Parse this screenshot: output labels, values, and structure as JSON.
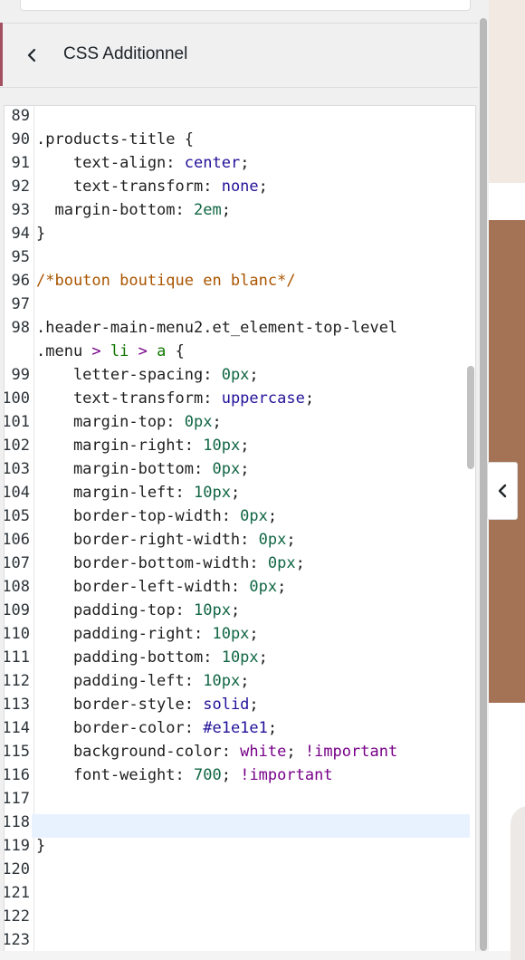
{
  "panel": {
    "title": "CSS Additionnel",
    "back_icon": "chevron-left-icon"
  },
  "editor": {
    "lines": [
      {
        "num": "89",
        "tokens": []
      },
      {
        "num": "90",
        "tokens": [
          {
            "t": "sel",
            "v": ".products-title"
          },
          {
            "t": "punc",
            "v": " {"
          }
        ]
      },
      {
        "num": "91",
        "tokens": [
          {
            "t": "prop",
            "v": "    text-align: "
          },
          {
            "t": "kw",
            "v": "center"
          },
          {
            "t": "punc",
            "v": ";"
          }
        ]
      },
      {
        "num": "92",
        "tokens": [
          {
            "t": "prop",
            "v": "    text-transform: "
          },
          {
            "t": "kw",
            "v": "none"
          },
          {
            "t": "punc",
            "v": ";"
          }
        ]
      },
      {
        "num": "93",
        "tokens": [
          {
            "t": "prop",
            "v": "  margin-bottom: "
          },
          {
            "t": "num",
            "v": "2em"
          },
          {
            "t": "punc",
            "v": ";"
          }
        ]
      },
      {
        "num": "94",
        "tokens": [
          {
            "t": "punc",
            "v": "}"
          }
        ]
      },
      {
        "num": "95",
        "tokens": []
      },
      {
        "num": "96",
        "tokens": [
          {
            "t": "comment",
            "v": "/*bouton boutique en blanc*/"
          }
        ]
      },
      {
        "num": "97",
        "tokens": []
      },
      {
        "num": "98",
        "tokens": [
          {
            "t": "sel",
            "v": ".header-main-menu2.et_element-top-level"
          }
        ]
      },
      {
        "num": "",
        "tokens": [
          {
            "t": "sel",
            "v": ".menu "
          },
          {
            "t": "op",
            "v": ">"
          },
          {
            "t": "sel",
            "v": " "
          },
          {
            "t": "tag",
            "v": "li"
          },
          {
            "t": "sel",
            "v": " "
          },
          {
            "t": "op",
            "v": ">"
          },
          {
            "t": "sel",
            "v": " "
          },
          {
            "t": "tag",
            "v": "a"
          },
          {
            "t": "punc",
            "v": " {"
          }
        ]
      },
      {
        "num": "99",
        "tokens": [
          {
            "t": "prop",
            "v": "    letter-spacing: "
          },
          {
            "t": "num",
            "v": "0px"
          },
          {
            "t": "punc",
            "v": ";"
          }
        ]
      },
      {
        "num": "100",
        "tokens": [
          {
            "t": "prop",
            "v": "    text-transform: "
          },
          {
            "t": "kw",
            "v": "uppercase"
          },
          {
            "t": "punc",
            "v": ";"
          }
        ]
      },
      {
        "num": "101",
        "tokens": [
          {
            "t": "prop",
            "v": "    margin-top: "
          },
          {
            "t": "num",
            "v": "0px"
          },
          {
            "t": "punc",
            "v": ";"
          }
        ]
      },
      {
        "num": "102",
        "tokens": [
          {
            "t": "prop",
            "v": "    margin-right: "
          },
          {
            "t": "num",
            "v": "10px"
          },
          {
            "t": "punc",
            "v": ";"
          }
        ]
      },
      {
        "num": "103",
        "tokens": [
          {
            "t": "prop",
            "v": "    margin-bottom: "
          },
          {
            "t": "num",
            "v": "0px"
          },
          {
            "t": "punc",
            "v": ";"
          }
        ]
      },
      {
        "num": "104",
        "tokens": [
          {
            "t": "prop",
            "v": "    margin-left: "
          },
          {
            "t": "num",
            "v": "10px"
          },
          {
            "t": "punc",
            "v": ";"
          }
        ]
      },
      {
        "num": "105",
        "tokens": [
          {
            "t": "prop",
            "v": "    border-top-width: "
          },
          {
            "t": "num",
            "v": "0px"
          },
          {
            "t": "punc",
            "v": ";"
          }
        ]
      },
      {
        "num": "106",
        "tokens": [
          {
            "t": "prop",
            "v": "    border-right-width: "
          },
          {
            "t": "num",
            "v": "0px"
          },
          {
            "t": "punc",
            "v": ";"
          }
        ]
      },
      {
        "num": "107",
        "tokens": [
          {
            "t": "prop",
            "v": "    border-bottom-width: "
          },
          {
            "t": "num",
            "v": "0px"
          },
          {
            "t": "punc",
            "v": ";"
          }
        ]
      },
      {
        "num": "108",
        "tokens": [
          {
            "t": "prop",
            "v": "    border-left-width: "
          },
          {
            "t": "num",
            "v": "0px"
          },
          {
            "t": "punc",
            "v": ";"
          }
        ]
      },
      {
        "num": "109",
        "tokens": [
          {
            "t": "prop",
            "v": "    padding-top: "
          },
          {
            "t": "num",
            "v": "10px"
          },
          {
            "t": "punc",
            "v": ";"
          }
        ]
      },
      {
        "num": "110",
        "tokens": [
          {
            "t": "prop",
            "v": "    padding-right: "
          },
          {
            "t": "num",
            "v": "10px"
          },
          {
            "t": "punc",
            "v": ";"
          }
        ]
      },
      {
        "num": "111",
        "tokens": [
          {
            "t": "prop",
            "v": "    padding-bottom: "
          },
          {
            "t": "num",
            "v": "10px"
          },
          {
            "t": "punc",
            "v": ";"
          }
        ]
      },
      {
        "num": "112",
        "tokens": [
          {
            "t": "prop",
            "v": "    padding-left: "
          },
          {
            "t": "num",
            "v": "10px"
          },
          {
            "t": "punc",
            "v": ";"
          }
        ]
      },
      {
        "num": "113",
        "tokens": [
          {
            "t": "prop",
            "v": "    border-style: "
          },
          {
            "t": "kw",
            "v": "solid"
          },
          {
            "t": "punc",
            "v": ";"
          }
        ]
      },
      {
        "num": "114",
        "tokens": [
          {
            "t": "prop",
            "v": "    border-color: "
          },
          {
            "t": "kw",
            "v": "#e1e1e1"
          },
          {
            "t": "punc",
            "v": ";"
          }
        ]
      },
      {
        "num": "115",
        "tokens": [
          {
            "t": "prop",
            "v": "    background-color: "
          },
          {
            "t": "imp",
            "v": "white"
          },
          {
            "t": "punc",
            "v": "; "
          },
          {
            "t": "imp",
            "v": "!important"
          }
        ]
      },
      {
        "num": "116",
        "tokens": [
          {
            "t": "prop",
            "v": "    font-weight: "
          },
          {
            "t": "num",
            "v": "700"
          },
          {
            "t": "punc",
            "v": "; "
          },
          {
            "t": "imp",
            "v": "!important"
          }
        ]
      },
      {
        "num": "117",
        "tokens": []
      },
      {
        "num": "118",
        "tokens": []
      },
      {
        "num": "119",
        "tokens": [
          {
            "t": "punc",
            "v": "}"
          }
        ]
      },
      {
        "num": "120",
        "tokens": []
      },
      {
        "num": "121",
        "tokens": []
      },
      {
        "num": "122",
        "tokens": []
      },
      {
        "num": "123",
        "tokens": []
      }
    ]
  },
  "preview": {
    "collapse_icon": "chevron-left-icon"
  }
}
